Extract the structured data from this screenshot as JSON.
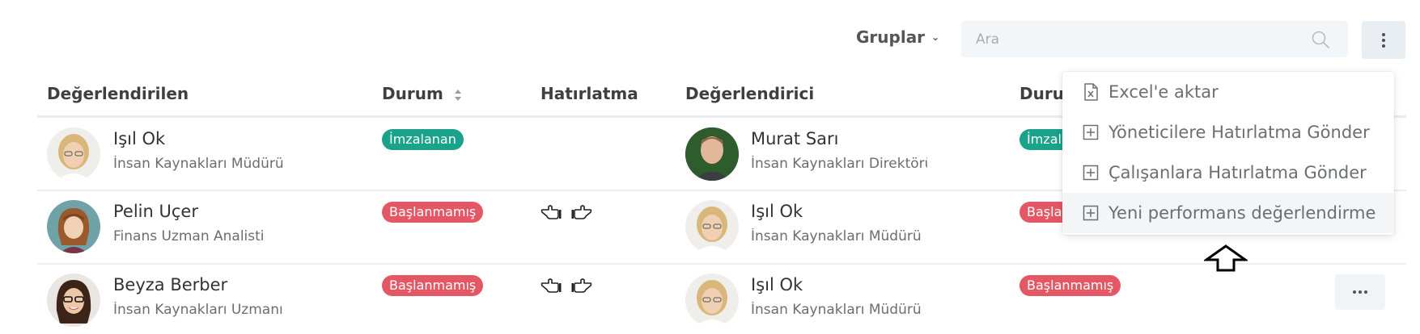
{
  "toolbar": {
    "groups_label": "Gruplar",
    "search_placeholder": "Ara"
  },
  "table": {
    "headers": {
      "evaluated": "Değerlendirilen",
      "status": "Durum",
      "reminder": "Hatırlatma",
      "evaluator": "Değerlendirici",
      "status2": "Durum"
    },
    "rows": [
      {
        "evaluated_name": "Işıl Ok",
        "evaluated_title": "İnsan Kaynakları Müdürü",
        "status": "İmzalanan",
        "evaluator_name": "Murat Sarı",
        "evaluator_title": "İnsan Kaynakları Direktörü",
        "status2": "İmzalanan"
      },
      {
        "evaluated_name": "Pelin Uçer",
        "evaluated_title": "Finans Uzman Analisti",
        "status": "Başlanmamış",
        "evaluator_name": "Işıl Ok",
        "evaluator_title": "İnsan Kaynakları Müdürü",
        "status2": "Başlanmamış"
      },
      {
        "evaluated_name": "Beyza Berber",
        "evaluated_title": "İnsan Kaynakları Uzmanı",
        "status": "Başlanmamış",
        "evaluator_name": "Işıl Ok",
        "evaluator_title": "İnsan Kaynakları Müdürü",
        "status2": "Başlanmamış"
      }
    ]
  },
  "menu": {
    "items": [
      {
        "label": "Excel'e aktar",
        "icon": "excel-file-icon"
      },
      {
        "label": "Yöneticilere Hatırlatma Gönder",
        "icon": "plus-square-icon"
      },
      {
        "label": "Çalışanlara Hatırlatma Gönder",
        "icon": "plus-square-icon"
      },
      {
        "label": "Yeni performans değerlendirme",
        "icon": "plus-square-icon"
      }
    ]
  },
  "colors": {
    "badge_signed": "#1aa28b",
    "badge_not_started": "#e45865"
  }
}
